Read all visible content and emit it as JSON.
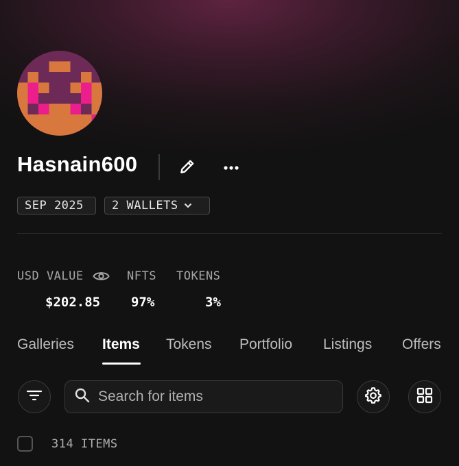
{
  "profile": {
    "username": "Hasnain600",
    "joined": "SEP 2025",
    "wallets": "2 WALLETS"
  },
  "icons": {
    "edit": "pencil-icon",
    "more": "more-horizontal-icon",
    "eye": "eye-icon",
    "wallets_chevron": "chevron-down-icon",
    "filter": "filter-icon",
    "search": "search-icon",
    "settings": "gear-icon",
    "view": "grid-view-icon"
  },
  "stats": {
    "usd_label": "USD VALUE",
    "usd_value": "$202.85",
    "nfts_label": "NFTS",
    "nfts_value": "97%",
    "tokens_label": "TOKENS",
    "tokens_value": "3%"
  },
  "tabs": [
    {
      "label": "Galleries"
    },
    {
      "label": "Items",
      "active": true
    },
    {
      "label": "Tokens"
    },
    {
      "label": "Portfolio"
    },
    {
      "label": "Listings"
    },
    {
      "label": "Offers"
    }
  ],
  "toolbar": {
    "search_placeholder": "Search for items"
  },
  "items": {
    "count_label": "314 ITEMS"
  },
  "colors": {
    "background": "#121212",
    "glow": "#5e2340",
    "avatar_bg": "#6e2a56",
    "avatar_orange": "#d9783e",
    "avatar_pink": "#ec1e8c"
  }
}
